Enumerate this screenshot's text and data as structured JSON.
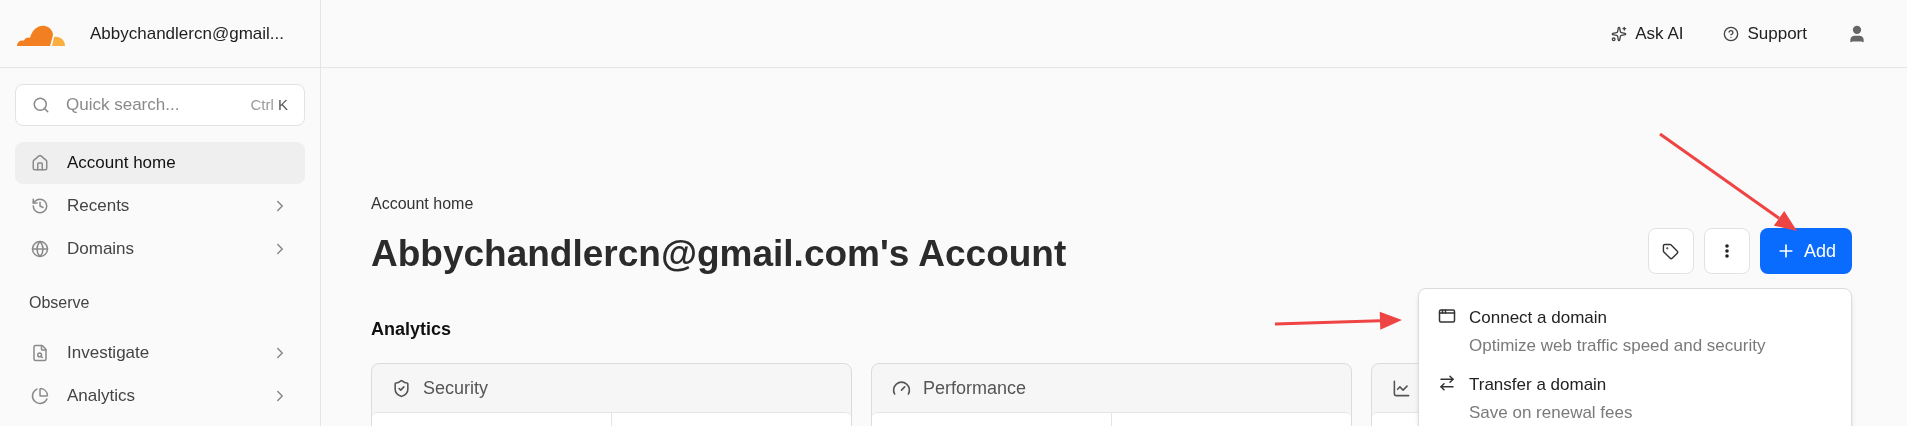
{
  "account": {
    "name": "Abbychandlercn@gmail..."
  },
  "search": {
    "placeholder": "Quick search...",
    "shortcut": [
      "Ctrl",
      "K"
    ]
  },
  "sidebar": {
    "items": [
      {
        "kind": "item",
        "label": "Account home",
        "selected": true,
        "chevron": false
      },
      {
        "kind": "item",
        "label": "Recents",
        "selected": false,
        "chevron": true
      },
      {
        "kind": "item",
        "label": "Domains",
        "selected": false,
        "chevron": true
      },
      {
        "kind": "section",
        "label": "Observe"
      },
      {
        "kind": "item",
        "label": "Investigate",
        "selected": false,
        "chevron": true
      },
      {
        "kind": "item",
        "label": "Analytics",
        "selected": false,
        "chevron": true
      }
    ]
  },
  "header": {
    "actions": [
      {
        "label": "Ask AI"
      },
      {
        "label": "Support"
      }
    ]
  },
  "page": {
    "breadcrumb": "Account home",
    "title": "Abbychandlercn@gmail.com's Account",
    "section": "Analytics",
    "cards": [
      {
        "title": "Security"
      },
      {
        "title": "Performance"
      }
    ]
  },
  "add_button": {
    "label": "Add"
  },
  "add_menu": {
    "items": [
      {
        "title": "Connect a domain",
        "description": "Optimize web traffic speed and security"
      },
      {
        "title": "Transfer a domain",
        "description": "Save on renewal fees"
      }
    ]
  }
}
